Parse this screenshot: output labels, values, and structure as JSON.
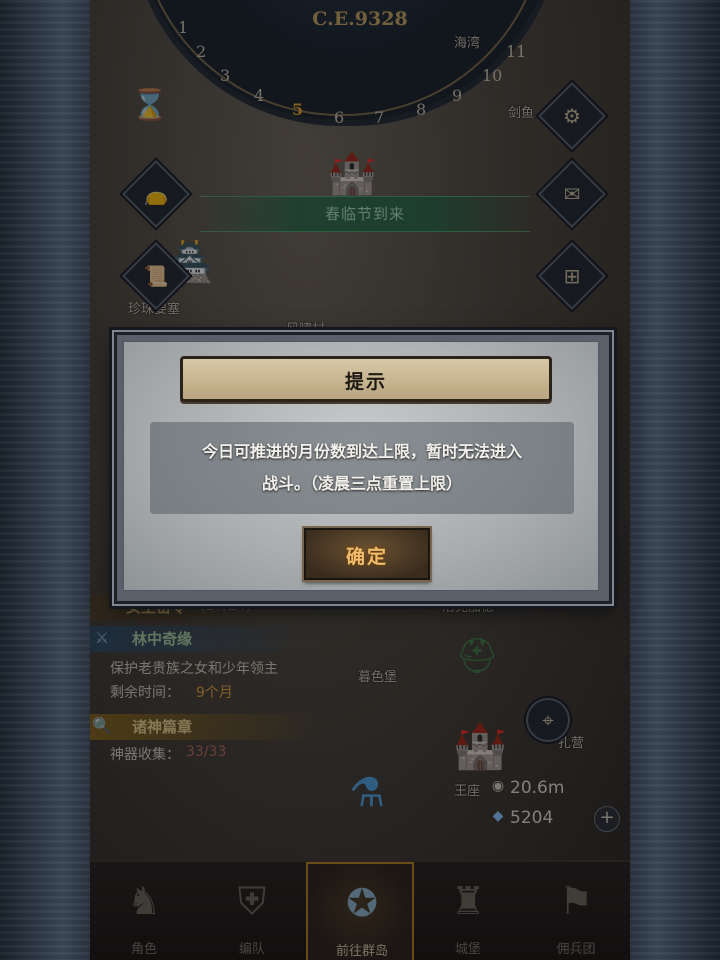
{
  "calendar": {
    "year": "C.E.9328",
    "months": [
      "1",
      "2",
      "3",
      "4",
      "5",
      "6",
      "7",
      "8",
      "9",
      "10",
      "11"
    ],
    "current_month": "5"
  },
  "event_banner": "春临节到来",
  "map_labels": {
    "top_right": "海湾",
    "sword_town": "剑鱼",
    "pearl_fort": "珍珠要塞",
    "wind_village": "风啸村",
    "dusk_castle": "暮色堡",
    "hidden_right": "洛克加德",
    "throne": "王座",
    "camp": "扎营"
  },
  "quests": {
    "queen_secret": {
      "title": "女王密令",
      "progress": "(27/24)"
    },
    "forest": {
      "title": "林中奇缘",
      "desc": "保护老贵族之女和少年领主",
      "time_label": "剩余时间：",
      "time_value": "9个月"
    },
    "gods": {
      "title": "诸神篇章",
      "label": "神器收集：",
      "value": "33/33"
    }
  },
  "resources": {
    "distance": "20.6m",
    "crystals": "5204"
  },
  "nav": {
    "items": [
      {
        "label": "角色",
        "icon": "knight-icon"
      },
      {
        "label": "编队",
        "icon": "helmet-icon"
      },
      {
        "label": "前往群岛",
        "icon": "islands-icon"
      },
      {
        "label": "城堡",
        "icon": "castle-icon"
      },
      {
        "label": "佣兵团",
        "icon": "banner-icon"
      }
    ]
  },
  "dialog": {
    "title": "提示",
    "message_line1": "今日可推进的月份数到达上限，暂时无法进入",
    "message_line2": "战斗。（凌晨三点重置上限）",
    "confirm": "确定"
  },
  "colors": {
    "accent_gold": "#f2bd6c",
    "quest_green": "#a9cfa3",
    "event_green": "#a7e0b6",
    "highlight_orange": "#e9a52b"
  }
}
